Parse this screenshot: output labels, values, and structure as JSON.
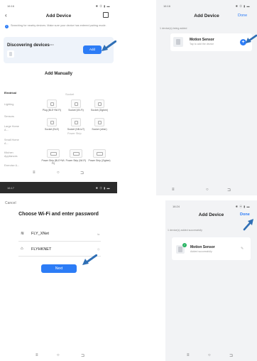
{
  "colors": {
    "accent": "#2c7cf6",
    "arrow": "#2f6fb5",
    "success": "#28b463"
  },
  "nav_icons": [
    "menu-icon",
    "home-icon",
    "back-nav-icon"
  ],
  "screen1": {
    "time": "16:16",
    "title": "Add Device",
    "hint": "Searching for nearby devices. Make sure your device has entered pairing mode.",
    "discovering": "Discovering devices···",
    "add_label": "Add",
    "manual_title": "Add Manually",
    "categories": [
      "Electrical",
      "Lighting",
      "Sensors",
      "Large Home A...",
      "Small Home A...",
      "Kitchen Appliances",
      "Exercise &..."
    ],
    "socket_header": "Socket",
    "tiles_row1": [
      "Plug (BLE+Wi-Fi)",
      "Socket (Wi-Fi)",
      "Socket (Zigbee)"
    ],
    "tiles_row2": [
      "Socket (BLE)",
      "Socket (NB-IoT)",
      "Socket (other)"
    ],
    "power_strip_header": "Power Strip",
    "tiles_row3": [
      "Power Strip (BLE+Wi-Fi)",
      "Power Strip (Wi-Fi)",
      "Power Strip (Zigbee)"
    ]
  },
  "screen2": {
    "time": "16:16",
    "title": "Add Device",
    "done": "Done",
    "count": "1 device(s) being added",
    "device_name": "Motion Sensor",
    "device_sub": "Tap to add the device"
  },
  "screen3": {
    "time": "16:17",
    "cancel": "Cancel",
    "title": "Choose Wi-Fi and enter password",
    "wifi_name": "FLY_XNet",
    "wifi_right": "⇆",
    "password": "FLYHKNET",
    "next": "Next"
  },
  "screen4": {
    "time": "16:24",
    "title": "Add Device",
    "done": "Done",
    "count": "1 device(s) added successfully",
    "device_name": "Motion Sensor",
    "device_sub": "Added successfully"
  }
}
